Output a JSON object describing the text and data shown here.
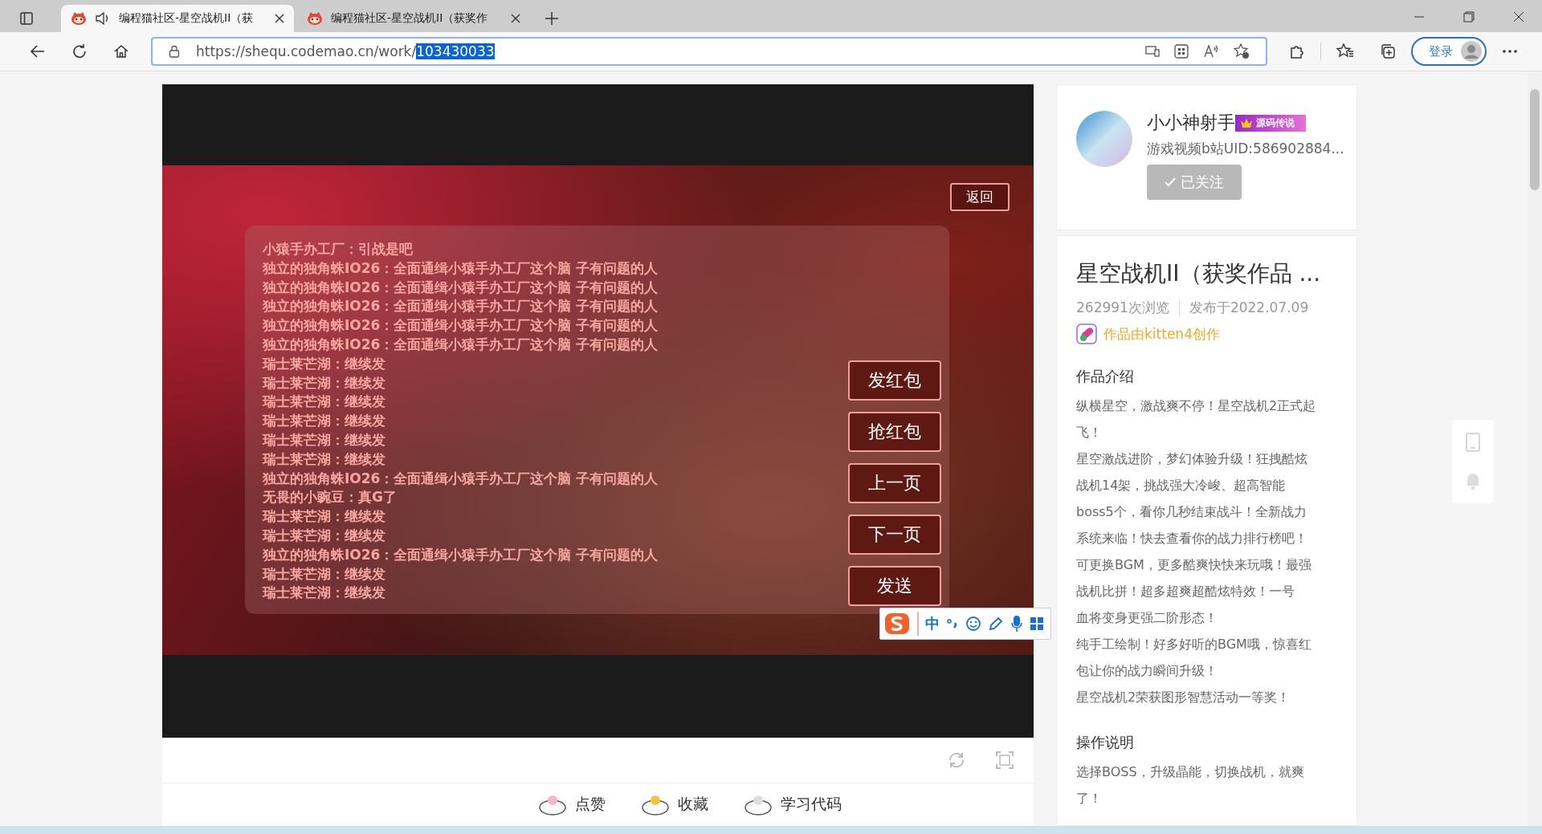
{
  "browser": {
    "tabs": [
      {
        "title": "编程猫社区-星空战机II（获",
        "selected": true,
        "audio": true
      },
      {
        "title": "编程猫社区-星空战机II（获奖作",
        "selected": false,
        "audio": false
      }
    ],
    "address": {
      "url": "https://shequ.codemao.cn/work/",
      "url_selected": "103430033"
    },
    "profile_button": "登录"
  },
  "game": {
    "back_button": "返回",
    "chat": [
      "小猿手办工厂：引战是吧",
      "独立的独角蛛IO26：全面通缉小猿手办工厂这个脑 子有问题的人",
      "独立的独角蛛IO26：全面通缉小猿手办工厂这个脑 子有问题的人",
      "独立的独角蛛IO26：全面通缉小猿手办工厂这个脑 子有问题的人",
      "独立的独角蛛IO26：全面通缉小猿手办工厂这个脑 子有问题的人",
      "独立的独角蛛IO26：全面通缉小猿手办工厂这个脑 子有问题的人",
      "瑞士莱芒湖：继续发",
      "瑞士莱芒湖：继续发",
      "瑞士莱芒湖：继续发",
      "瑞士莱芒湖：继续发",
      "瑞士莱芒湖：继续发",
      "瑞士莱芒湖：继续发",
      "独立的独角蛛IO26：全面通缉小猿手办工厂这个脑 子有问题的人",
      "无畏的小豌豆：真G了",
      "瑞士莱芒湖：继续发",
      "瑞士莱芒湖：继续发",
      "独立的独角蛛IO26：全面通缉小猿手办工厂这个脑 子有问题的人",
      "瑞士莱芒湖：继续发",
      "瑞士莱芒湖：继续发"
    ],
    "buttons": [
      "发红包",
      "抢红包",
      "上一页",
      "下一页",
      "发送"
    ]
  },
  "ime_toolbar": {
    "mode": "中"
  },
  "actions": [
    {
      "kind": "like",
      "label": "点赞"
    },
    {
      "kind": "collect",
      "label": "收藏"
    },
    {
      "kind": "code",
      "label": "学习代码"
    }
  ],
  "author": {
    "name": "小小神射手",
    "badge": "源码传说",
    "bio": "游戏视频b站UID:586902884...",
    "follow_button": "已关注",
    "following": true
  },
  "work": {
    "title": "星空战机II（获奖作品 ...",
    "views": "262991次浏览",
    "published": "发布于2022.07.09",
    "made_with": "作品由kitten4创作",
    "sections": [
      {
        "heading": "作品介绍",
        "lines": [
          "纵横星空，激战爽不停！星空战机2正式起",
          "飞！",
          "星空激战进阶，梦幻体验升级！狂拽酷炫",
          "战机14架，挑战强大冷峻、超高智能",
          "boss5个，看你几秒结束战斗！全新战力",
          "系统来临！快去查看你的战力排行榜吧！",
          "可更换BGM，更多酷爽快快来玩哦！最强",
          "战机比拼！超多超爽超酷炫特效！一号",
          "血将变身更强二阶形态！",
          "纯手工绘制！好多好听的BGM哦，惊喜红",
          "包让你的战力瞬间升级！",
          "星空战机2荣获图形智慧活动一等奖！"
        ]
      },
      {
        "heading": "操作说明",
        "lines": [
          "选择BOSS，升级晶能，切换战机，就爽",
          "了！"
        ]
      }
    ]
  }
}
